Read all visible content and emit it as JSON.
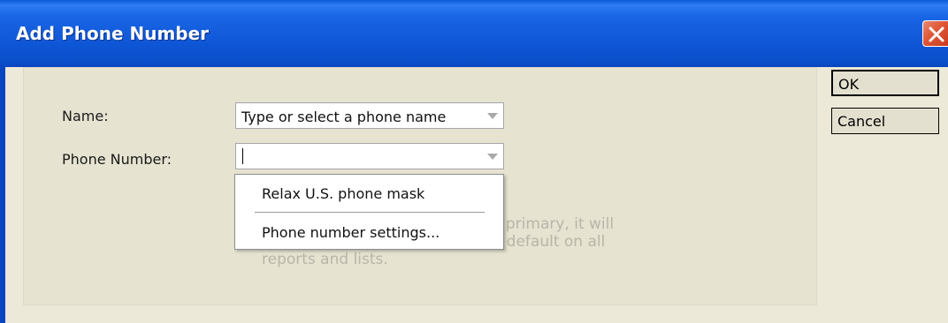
{
  "window": {
    "title": "Add Phone Number"
  },
  "form": {
    "name_label": "Name:",
    "name_value": "Type or select a phone name",
    "phone_label": "Phone Number:",
    "phone_value": ""
  },
  "hint": {
    "line1": "If you set this phone number as primary, it will",
    "line2": "be the phone number shown by default on all",
    "line3": "reports and lists."
  },
  "dropdown": {
    "items": [
      "Relax U.S. phone mask",
      "Phone number settings..."
    ]
  },
  "buttons": {
    "ok": "OK",
    "cancel": "Cancel"
  },
  "colors": {
    "titlebar": "#0a4fca",
    "close": "#e05a3a",
    "dialog_bg": "#ece9d8"
  }
}
